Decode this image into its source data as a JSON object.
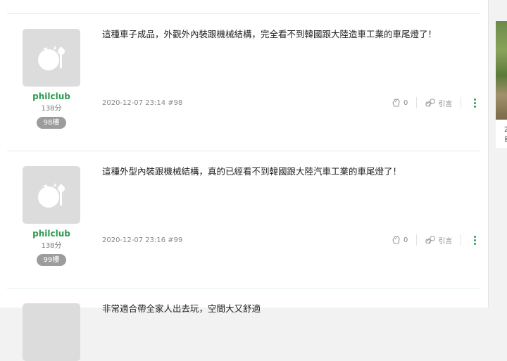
{
  "posts": [
    {
      "username": "philclub",
      "score": "138分",
      "floor": "98樓",
      "content": "這種車子成品，外觀外內裝跟機械結構，完全看不到韓國跟大陸造車工業的車尾燈了！",
      "meta": "2020-12-07 23:14 #98",
      "like_count": "0",
      "quote_label": "引言"
    },
    {
      "username": "philclub",
      "score": "138分",
      "floor": "99樓",
      "content": "這種外型內裝跟機械結構，真的已經看不到韓國跟大陸汽車工業的車尾燈了！",
      "meta": "2020-12-07 23:16 #99",
      "like_count": "0",
      "quote_label": "引言"
    }
  ],
  "next_post_preview": "非常適合帶全家人出去玩，空間大又舒適",
  "sidebar": {
    "snippet_line1": "2",
    "snippet_line2": "自"
  },
  "colors": {
    "accent": "#2f9a52",
    "badge": "#9c9c9c",
    "avatar_bg": "#dcdcdc"
  }
}
